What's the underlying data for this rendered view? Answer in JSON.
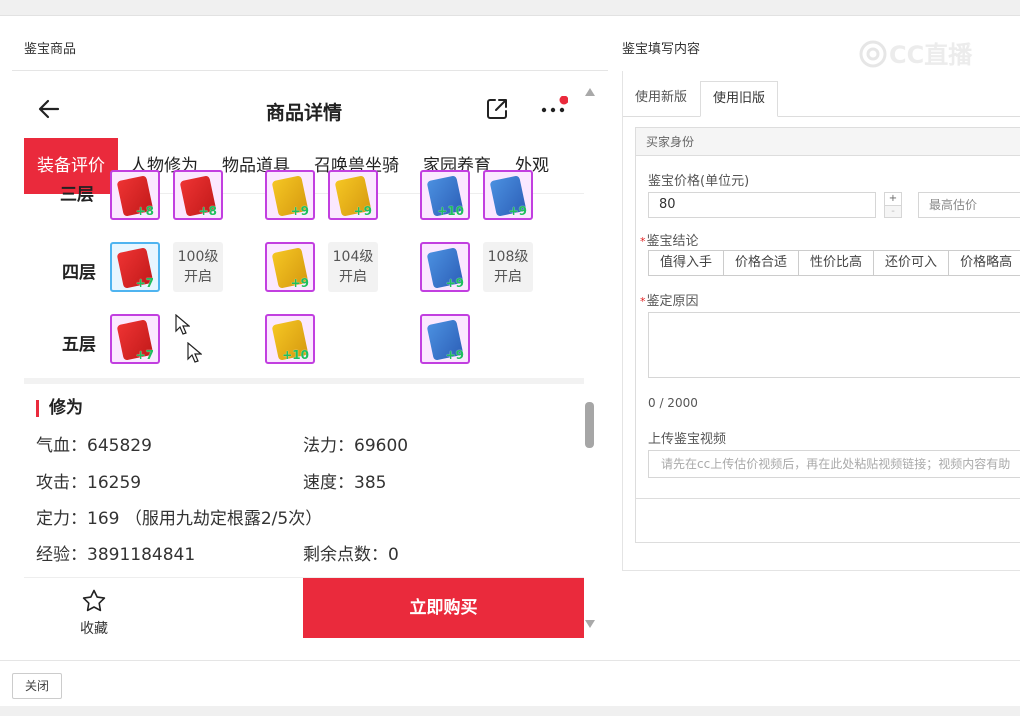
{
  "left_panel": {
    "title": "鉴宝商品"
  },
  "right_panel": {
    "title": "鉴宝填写内容"
  },
  "watermark": "CC直播",
  "phone": {
    "nav": {
      "title": "商品详情"
    },
    "tabs": [
      "装备评价",
      "人物修为",
      "物品道具",
      "召唤兽坐骑",
      "家园养育",
      "外观"
    ],
    "layers": [
      {
        "label": "三层",
        "items": [
          "+8",
          "+8",
          "+9",
          "+9",
          "+10",
          "+9"
        ]
      },
      {
        "label": "四层",
        "items": [
          "+7",
          "+9",
          "+9"
        ],
        "locks": [
          "100级\n开启",
          "104级\n开启",
          "108级\n开启"
        ]
      },
      {
        "label": "五层",
        "items": [
          "+7",
          "+10",
          "+9"
        ]
      }
    ],
    "locks": [
      {
        "line1": "100级",
        "line2": "开启"
      },
      {
        "line1": "104级",
        "line2": "开启"
      },
      {
        "line1": "108级",
        "line2": "开启"
      }
    ],
    "xiuwei": {
      "title": "修为",
      "qixue": "气血：645829",
      "fali": "法力：69600",
      "gongji": "攻击：16259",
      "sudu": "速度：385",
      "dingli": "定力：169 （服用九劫定根露2/5次）",
      "jingyan": "经验：3891184841",
      "shengyu": "剩余点数：0"
    },
    "bottom": {
      "fav_label": "收藏",
      "buy_label": "立即购买"
    }
  },
  "form": {
    "tabs": [
      "使用新版",
      "使用旧版"
    ],
    "active_tab": "使用旧版",
    "section_head": "买家身份",
    "price_label": "鉴宝价格(单位元)",
    "price_value": "80",
    "stepper_plus": "+",
    "stepper_minus": "-",
    "max_placeholder": "最高估价",
    "conclusion_label": "鉴宝结论",
    "conclusion_options": [
      "值得入手",
      "价格合适",
      "性价比高",
      "还价可入",
      "价格略高"
    ],
    "reason_label": "鉴定原因",
    "counter": "0 / 2000",
    "video_label": "上传鉴宝视频",
    "video_placeholder": "请先在cc上传估价视频后，再在此处粘贴视频链接；视频内容有助"
  },
  "footer": {
    "close_label": "关闭"
  },
  "colors": {
    "accent": "#ea2a3c",
    "item_border_purple": "#c23fe0",
    "item_border_blue": "#4fb4f0",
    "level_green": "#1fbf5e"
  }
}
